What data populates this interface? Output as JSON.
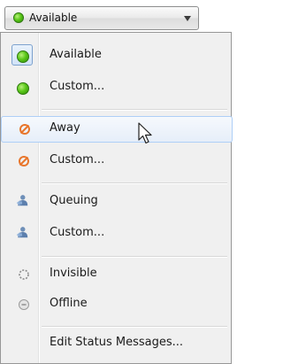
{
  "combo": {
    "label": "Available",
    "icon": "available-dot-icon"
  },
  "menu": {
    "items": [
      {
        "label": "Available",
        "icon": "available-dot-icon",
        "selected": true
      },
      {
        "label": "Custom...",
        "icon": "available-dot-icon"
      },
      {
        "label": "Away",
        "icon": "away-icon",
        "hovered": true
      },
      {
        "label": "Custom...",
        "icon": "away-icon"
      },
      {
        "label": "Queuing",
        "icon": "queuing-user-icon"
      },
      {
        "label": "Custom...",
        "icon": "queuing-user-icon"
      },
      {
        "label": "Invisible",
        "icon": "invisible-icon"
      },
      {
        "label": "Offline",
        "icon": "offline-icon"
      },
      {
        "label": "Edit Status Messages...",
        "icon": ""
      }
    ]
  },
  "colors": {
    "available": "#4cbf14",
    "away": "#e8762c",
    "hover_border": "#aecff7"
  }
}
